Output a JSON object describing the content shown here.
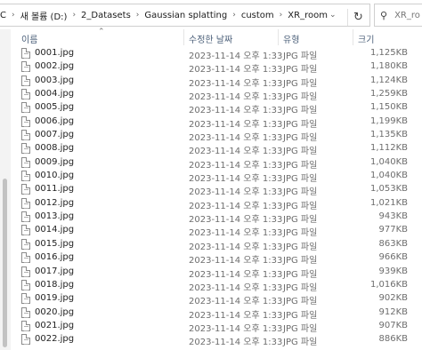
{
  "address_bar": {
    "crumbs": [
      "C",
      "새 볼륨 (D:)",
      "2_Datasets",
      "Gaussian splatting",
      "custom",
      "XR_room"
    ],
    "separator": "›",
    "refresh_icon": "refresh-icon"
  },
  "search": {
    "placeholder": "XR_ro"
  },
  "columns": {
    "name": "이름",
    "date": "수정한 날짜",
    "type": "유형",
    "size": "크기"
  },
  "files": [
    {
      "name": "0001.jpg",
      "date": "2023-11-14 오후 1:33",
      "type": "JPG 파일",
      "size": "1,125KB"
    },
    {
      "name": "0002.jpg",
      "date": "2023-11-14 오후 1:33",
      "type": "JPG 파일",
      "size": "1,180KB"
    },
    {
      "name": "0003.jpg",
      "date": "2023-11-14 오후 1:33",
      "type": "JPG 파일",
      "size": "1,124KB"
    },
    {
      "name": "0004.jpg",
      "date": "2023-11-14 오후 1:33",
      "type": "JPG 파일",
      "size": "1,259KB"
    },
    {
      "name": "0005.jpg",
      "date": "2023-11-14 오후 1:33",
      "type": "JPG 파일",
      "size": "1,150KB"
    },
    {
      "name": "0006.jpg",
      "date": "2023-11-14 오후 1:33",
      "type": "JPG 파일",
      "size": "1,199KB"
    },
    {
      "name": "0007.jpg",
      "date": "2023-11-14 오후 1:33",
      "type": "JPG 파일",
      "size": "1,135KB"
    },
    {
      "name": "0008.jpg",
      "date": "2023-11-14 오후 1:33",
      "type": "JPG 파일",
      "size": "1,112KB"
    },
    {
      "name": "0009.jpg",
      "date": "2023-11-14 오후 1:33",
      "type": "JPG 파일",
      "size": "1,040KB"
    },
    {
      "name": "0010.jpg",
      "date": "2023-11-14 오후 1:33",
      "type": "JPG 파일",
      "size": "1,040KB"
    },
    {
      "name": "0011.jpg",
      "date": "2023-11-14 오후 1:33",
      "type": "JPG 파일",
      "size": "1,053KB"
    },
    {
      "name": "0012.jpg",
      "date": "2023-11-14 오후 1:33",
      "type": "JPG 파일",
      "size": "1,021KB"
    },
    {
      "name": "0013.jpg",
      "date": "2023-11-14 오후 1:33",
      "type": "JPG 파일",
      "size": "943KB"
    },
    {
      "name": "0014.jpg",
      "date": "2023-11-14 오후 1:33",
      "type": "JPG 파일",
      "size": "977KB"
    },
    {
      "name": "0015.jpg",
      "date": "2023-11-14 오후 1:33",
      "type": "JPG 파일",
      "size": "863KB"
    },
    {
      "name": "0016.jpg",
      "date": "2023-11-14 오후 1:33",
      "type": "JPG 파일",
      "size": "966KB"
    },
    {
      "name": "0017.jpg",
      "date": "2023-11-14 오후 1:33",
      "type": "JPG 파일",
      "size": "939KB"
    },
    {
      "name": "0018.jpg",
      "date": "2023-11-14 오후 1:33",
      "type": "JPG 파일",
      "size": "1,016KB"
    },
    {
      "name": "0019.jpg",
      "date": "2023-11-14 오후 1:33",
      "type": "JPG 파일",
      "size": "902KB"
    },
    {
      "name": "0020.jpg",
      "date": "2023-11-14 오후 1:33",
      "type": "JPG 파일",
      "size": "912KB"
    },
    {
      "name": "0021.jpg",
      "date": "2023-11-14 오후 1:33",
      "type": "JPG 파일",
      "size": "907KB"
    },
    {
      "name": "0022.jpg",
      "date": "2023-11-14 오후 1:33",
      "type": "JPG 파일",
      "size": "886KB"
    }
  ],
  "colors": {
    "header_text": "#4c607a",
    "secondary_text": "#6d6d6d",
    "border": "#cfcfcf"
  }
}
